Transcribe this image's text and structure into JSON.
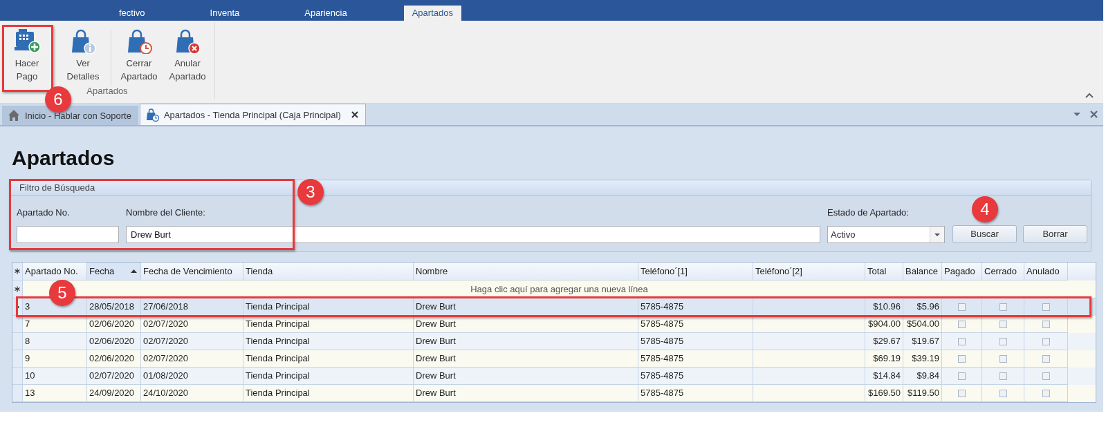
{
  "top_tabs": [
    {
      "label": "fectivo",
      "selected": false
    },
    {
      "label": "Inventa",
      "selected": false
    },
    {
      "label": "Apariencia",
      "selected": false
    },
    {
      "label": "Apartados",
      "selected": true
    }
  ],
  "ribbon": {
    "group": "Apartados",
    "buttons": [
      {
        "label": "Hacer Pago"
      },
      {
        "label": "Ver Detalles"
      },
      {
        "label": "Cerrar Apartado"
      },
      {
        "label": "Anular Apartado"
      }
    ]
  },
  "doc_tabs": [
    {
      "label": "Inicio - Hablar con Soporte",
      "selected": false,
      "closable": false
    },
    {
      "label": "Apartados - Tienda Principal (Caja Principal)",
      "selected": true,
      "closable": true
    }
  ],
  "page_title": "Apartados",
  "filter": {
    "title": "Filtro de Búsqueda",
    "fields": [
      {
        "kind": "text",
        "label": "Apartado No."
      },
      {
        "kind": "text",
        "label": "Nombre del Cliente:",
        "value": "Drew Burt"
      },
      {
        "kind": "combo",
        "label": "Estado de Apartado:",
        "value": "Activo"
      }
    ],
    "buttons": [
      "Buscar",
      "Borrar"
    ]
  },
  "grid": {
    "columns": [
      {
        "label": "Apartado No.",
        "kind": "text",
        "sorted": false
      },
      {
        "label": "Fecha",
        "kind": "text",
        "sorted": true
      },
      {
        "label": "Fecha de Vencimiento",
        "kind": "text",
        "sorted": false
      },
      {
        "label": "Tienda",
        "kind": "text",
        "sorted": false
      },
      {
        "label": "Nombre",
        "kind": "text",
        "sorted": false
      },
      {
        "label": "Teléfono´[1]",
        "kind": "text",
        "sorted": false
      },
      {
        "label": "Teléfono´[2]",
        "kind": "text",
        "sorted": false
      },
      {
        "label": "Total",
        "kind": "money",
        "sorted": false
      },
      {
        "label": "Balance",
        "kind": "money",
        "sorted": false
      },
      {
        "label": "Pagado",
        "kind": "check",
        "sorted": false
      },
      {
        "label": "Cerrado",
        "kind": "check",
        "sorted": false
      },
      {
        "label": "Anulado",
        "kind": "check",
        "sorted": false
      }
    ],
    "new_row_hint": "Haga clic aquí para agregar una nueva línea",
    "rows": [
      {
        "selected": true,
        "cells": [
          "3",
          "28/05/2018",
          "27/06/2018",
          "Tienda Principal",
          "Drew Burt",
          "5785-4875",
          null,
          "$10.96",
          "$5.96",
          false,
          false,
          false
        ]
      },
      {
        "selected": false,
        "cells": [
          "7",
          "02/06/2020",
          "02/07/2020",
          "Tienda Principal",
          "Drew Burt",
          "5785-4875",
          null,
          "$904.00",
          "$504.00",
          false,
          false,
          false
        ]
      },
      {
        "selected": false,
        "cells": [
          "8",
          "02/06/2020",
          "02/07/2020",
          "Tienda Principal",
          "Drew Burt",
          "5785-4875",
          null,
          "$29.67",
          "$19.67",
          false,
          false,
          false
        ]
      },
      {
        "selected": false,
        "cells": [
          "9",
          "02/06/2020",
          "02/07/2020",
          "Tienda Principal",
          "Drew Burt",
          "5785-4875",
          null,
          "$69.19",
          "$39.19",
          false,
          false,
          false
        ]
      },
      {
        "selected": false,
        "cells": [
          "10",
          "02/07/2020",
          "01/08/2020",
          "Tienda Principal",
          "Drew Burt",
          "5785-4875",
          null,
          "$14.84",
          "$9.84",
          false,
          false,
          false
        ]
      },
      {
        "selected": false,
        "cells": [
          "13",
          "24/09/2020",
          "24/10/2020",
          "Tienda Principal",
          "Drew Burt",
          "5785-4875",
          null,
          "$169.50",
          "$119.50",
          false,
          false,
          false
        ]
      }
    ]
  },
  "callouts": [
    {
      "number": "6",
      "framed": true
    },
    {
      "number": "3",
      "framed": true
    },
    {
      "number": "4",
      "framed": false
    },
    {
      "number": "5",
      "framed": true
    }
  ]
}
